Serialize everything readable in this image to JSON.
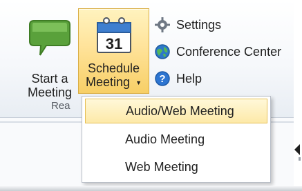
{
  "ribbon": {
    "start_meeting": {
      "line1": "Start a",
      "line2": "Meeting"
    },
    "schedule_meeting": {
      "line1": "Schedule",
      "line2": "Meeting",
      "calendar_day": "31"
    },
    "group_label": "Rea",
    "items": {
      "settings": "Settings",
      "conference_center": "Conference Center",
      "help": "Help"
    }
  },
  "dropdown": {
    "items": [
      "Audio/Web Meeting",
      "Audio Meeting",
      "Web Meeting"
    ]
  },
  "colors": {
    "selected_background": "#fde9a8",
    "selected_border": "#e6bf55",
    "meeting_green": "#5aa13b"
  },
  "icons": {
    "start_meeting": "green-speech-bubble-icon",
    "schedule_meeting": "calendar-icon",
    "settings": "gear-icon",
    "conference_center": "globe-icon",
    "help": "question-mark-icon",
    "chevron": "chevron-down-icon"
  }
}
